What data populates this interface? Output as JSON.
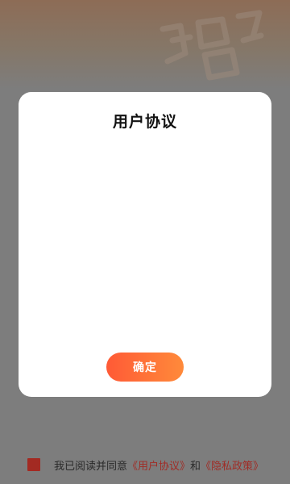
{
  "colors": {
    "accent_gradient_start": "#ff5a36",
    "accent_gradient_end": "#ff8a3a",
    "link": "#a02c26",
    "checkbox": "#a32a22",
    "overlay": "#7d7d7d"
  },
  "header": {
    "logo_icon": "brand-logo-icon"
  },
  "dialog": {
    "title": "用户协议",
    "body": "",
    "confirm_label": "确定"
  },
  "agreement": {
    "checkbox_icon": "checkbox-icon",
    "checked": true,
    "prefix": "我已阅读并同意",
    "user_agreement_link": "《用户协议》",
    "conjunction": "和",
    "privacy_policy_link": "《隐私政策》"
  }
}
